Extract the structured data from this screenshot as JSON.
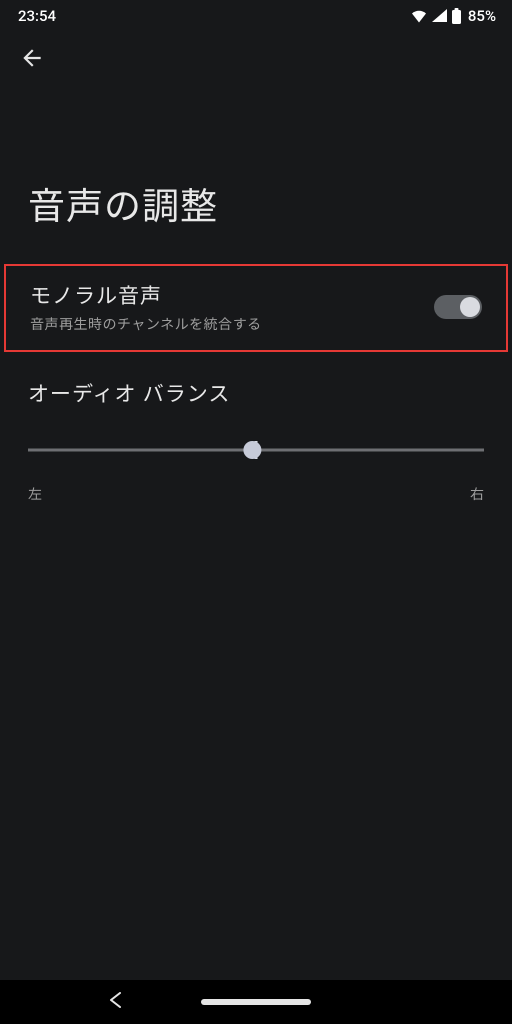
{
  "status": {
    "time": "23:54",
    "battery": "85%"
  },
  "page": {
    "title": "音声の調整"
  },
  "mono": {
    "title": "モノラル音声",
    "subtitle": "音声再生時のチャンネルを統合する"
  },
  "balance": {
    "title": "オーディオ バランス",
    "left": "左",
    "right": "右"
  }
}
